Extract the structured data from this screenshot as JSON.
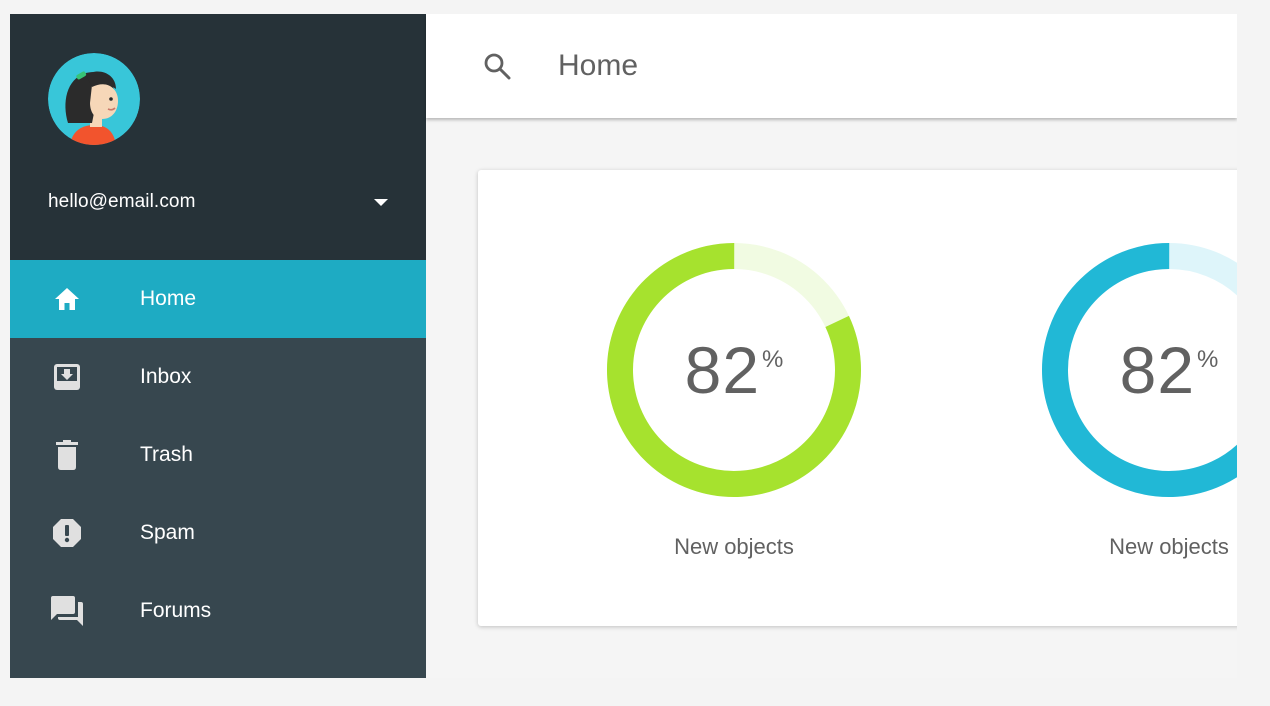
{
  "account": {
    "email": "hello@email.com",
    "avatar_icon": "user-avatar",
    "dropdown_icon": "caret-down-icon"
  },
  "nav": {
    "items": [
      {
        "label": "Home",
        "icon": "home-icon",
        "active": true
      },
      {
        "label": "Inbox",
        "icon": "inbox-icon",
        "active": false
      },
      {
        "label": "Trash",
        "icon": "trash-icon",
        "active": false
      },
      {
        "label": "Spam",
        "icon": "spam-icon",
        "active": false
      },
      {
        "label": "Forums",
        "icon": "forum-icon",
        "active": false
      }
    ]
  },
  "header": {
    "search_icon": "search-icon",
    "title": "Home"
  },
  "stats": [
    {
      "value": "82",
      "unit": "%",
      "label": "New objects",
      "percent": 82,
      "color": "#a6e22e",
      "track": "#f1fbe2"
    },
    {
      "value": "82",
      "unit": "%",
      "label": "New objects",
      "percent": 82,
      "color": "#21b8d6",
      "track": "#def5fa"
    }
  ],
  "colors": {
    "sidebar_dark": "#263238",
    "sidebar": "#37474f",
    "active_item": "#1eabc3"
  }
}
